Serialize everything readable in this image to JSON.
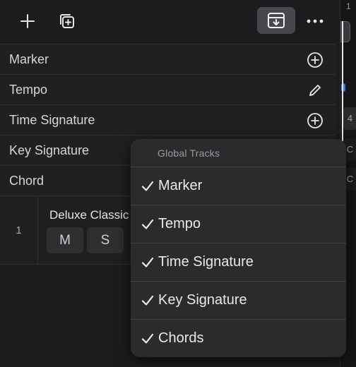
{
  "right_strip": {
    "bar_number": "1",
    "mini_values": [
      "4",
      "C",
      "C"
    ]
  },
  "global_track_rows": [
    {
      "label": "Marker",
      "action_icon": "add-circle-icon"
    },
    {
      "label": "Tempo",
      "action_icon": "pencil-icon"
    },
    {
      "label": "Time Signature",
      "action_icon": "add-circle-icon"
    },
    {
      "label": "Key Signature",
      "action_icon": ""
    },
    {
      "label": "Chord",
      "action_icon": ""
    }
  ],
  "track": {
    "number": "1",
    "name": "Deluxe Classic",
    "mute_label": "M",
    "solo_label": "S"
  },
  "popup": {
    "header": "Global Tracks",
    "items": [
      {
        "label": "Marker",
        "checked": true
      },
      {
        "label": "Tempo",
        "checked": true
      },
      {
        "label": "Time Signature",
        "checked": true
      },
      {
        "label": "Key Signature",
        "checked": true
      },
      {
        "label": "Chords",
        "checked": true
      }
    ]
  },
  "colors": {
    "background": "#1c1c1e",
    "popup": "#2b2b2e",
    "playhead_marker": "#3c7be8"
  }
}
